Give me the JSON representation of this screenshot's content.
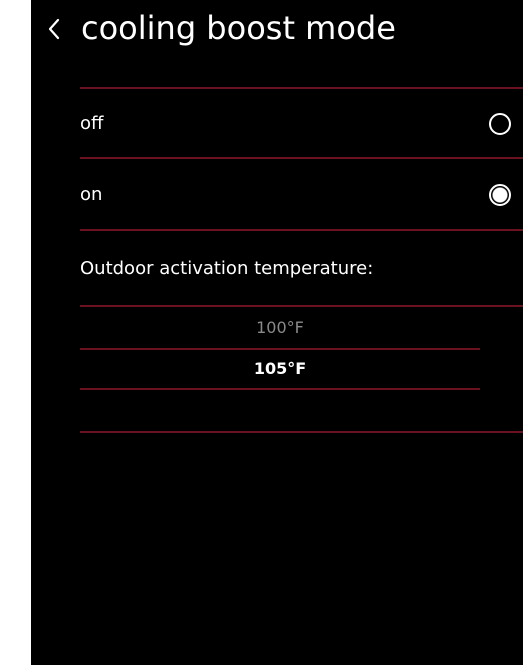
{
  "header": {
    "back_icon": "chevron-left-icon",
    "title": "cooling boost mode"
  },
  "options": [
    {
      "label": "off",
      "selected": false
    },
    {
      "label": "on",
      "selected": true
    }
  ],
  "activation": {
    "label": "Outdoor activation temperature:",
    "values": [
      "100°F",
      "105°F"
    ],
    "selected": "105°F"
  },
  "colors": {
    "background": "#000000",
    "divider": "#6b1220",
    "text": "#ffffff",
    "dim_text": "#8a8a8a"
  }
}
